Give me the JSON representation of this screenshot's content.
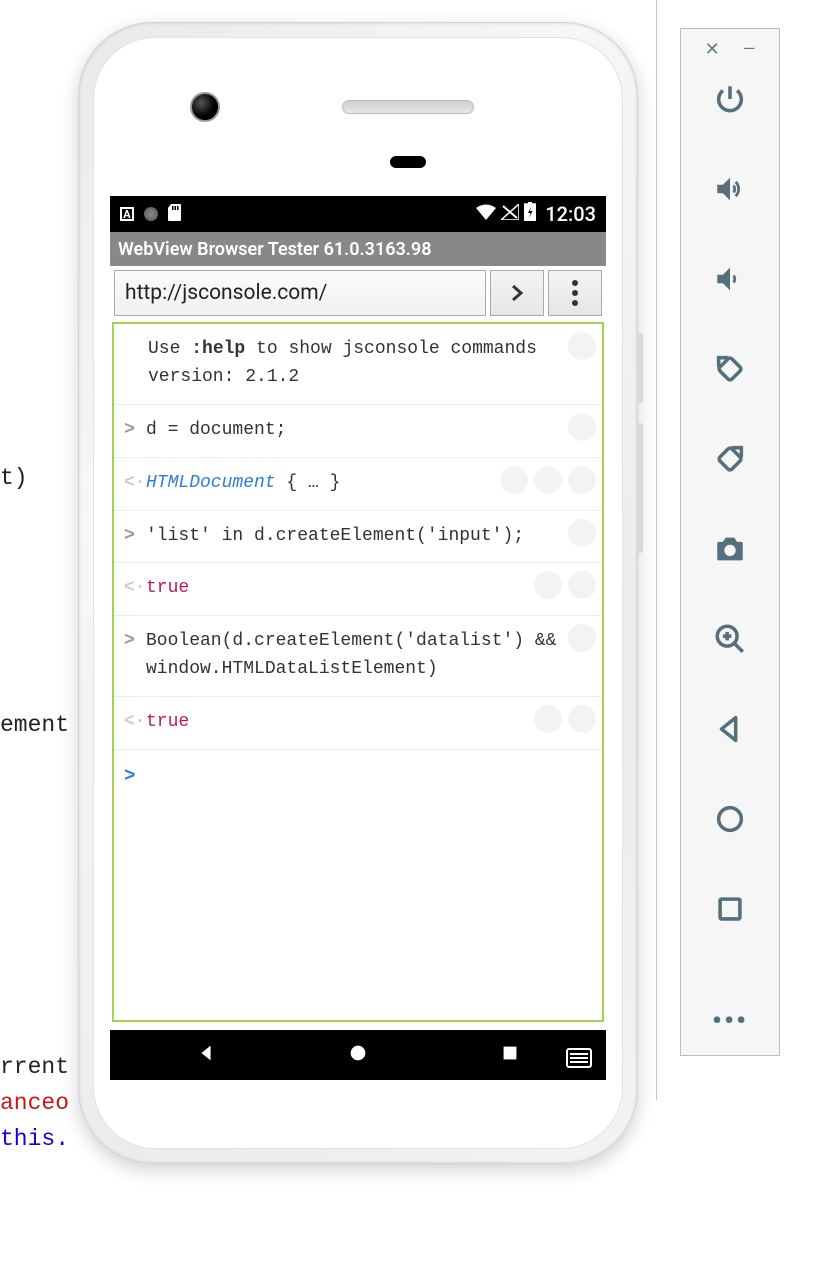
{
  "bg_code": {
    "frag1": "t)",
    "frag2": "ement",
    "frag3": "rrent",
    "frag4": "anceo",
    "frag5": "this."
  },
  "toolbar": {
    "close": "×",
    "minimize": "—",
    "buttons": [
      {
        "name": "power-icon"
      },
      {
        "name": "volume-up-icon"
      },
      {
        "name": "volume-down-icon"
      },
      {
        "name": "rotate-left-icon"
      },
      {
        "name": "rotate-right-icon"
      },
      {
        "name": "camera-icon"
      },
      {
        "name": "zoom-icon"
      },
      {
        "name": "back-icon"
      },
      {
        "name": "home-icon"
      },
      {
        "name": "overview-icon"
      }
    ],
    "more": "•••"
  },
  "statusbar": {
    "clock": "12:03"
  },
  "appbar": {
    "title": "WebView Browser Tester 61.0.3163.98"
  },
  "urlbar": {
    "url": "http://jsconsole.com/"
  },
  "console": {
    "help_line1_a": "Use ",
    "help_line1_b": ":help",
    "help_line1_c": " to show jsconsole commands",
    "help_line2": "version: 2.1.2",
    "entries": [
      {
        "type": "in",
        "text": "d = document;"
      },
      {
        "type": "out",
        "html": true,
        "text": "HTMLDocument",
        "suffix": " { … }"
      },
      {
        "type": "in",
        "text": "'list' in d.createElement('input');"
      },
      {
        "type": "out",
        "true": true,
        "text": "true"
      },
      {
        "type": "in",
        "text": "Boolean(d.createElement('datalist') && window.HTMLDataListElement)"
      },
      {
        "type": "out",
        "true": true,
        "text": "true"
      }
    ],
    "prompt": ">"
  }
}
